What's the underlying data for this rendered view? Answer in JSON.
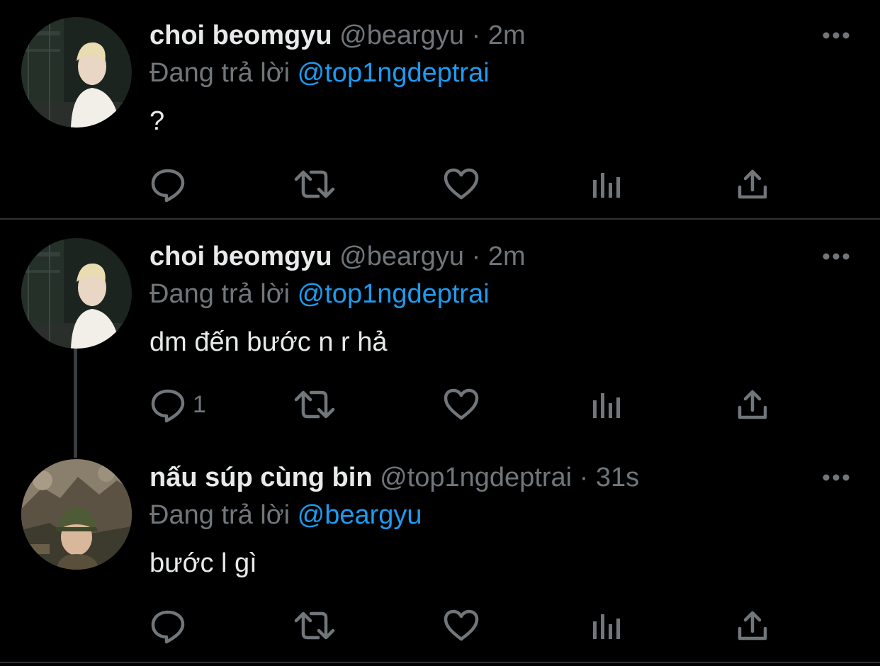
{
  "colors": {
    "background": "#000000",
    "text": "#e7e9ea",
    "secondary": "#71767b",
    "accent": "#1d9bf0",
    "divider": "#2f3336"
  },
  "tweets": [
    {
      "name": "choi beomgyu",
      "handle": "@beargyu",
      "separator": "·",
      "time": "2m",
      "reply_prefix": "Đang trả lời",
      "reply_to": "@top1ngdeptrai",
      "text": "?",
      "reply_count": "",
      "avatar": "person-photo-avatar",
      "more_icon": "more-options-icon"
    },
    {
      "name": "choi beomgyu",
      "handle": "@beargyu",
      "separator": "·",
      "time": "2m",
      "reply_prefix": "Đang trả lời",
      "reply_to": "@top1ngdeptrai",
      "text": "dm đến bước n r hả",
      "reply_count": "1",
      "avatar": "person-photo-avatar",
      "more_icon": "more-options-icon"
    },
    {
      "name": "nấu súp cùng bin",
      "handle": "@top1ngdeptrai",
      "separator": "·",
      "time": "31s",
      "reply_prefix": "Đang trả lời",
      "reply_to": "@beargyu",
      "text": "bước l gì",
      "reply_count": "",
      "avatar": "soldier-photo-avatar",
      "more_icon": "more-options-icon"
    }
  ],
  "action_icons": [
    "reply-icon",
    "retweet-icon",
    "like-icon",
    "analytics-icon",
    "share-icon"
  ]
}
